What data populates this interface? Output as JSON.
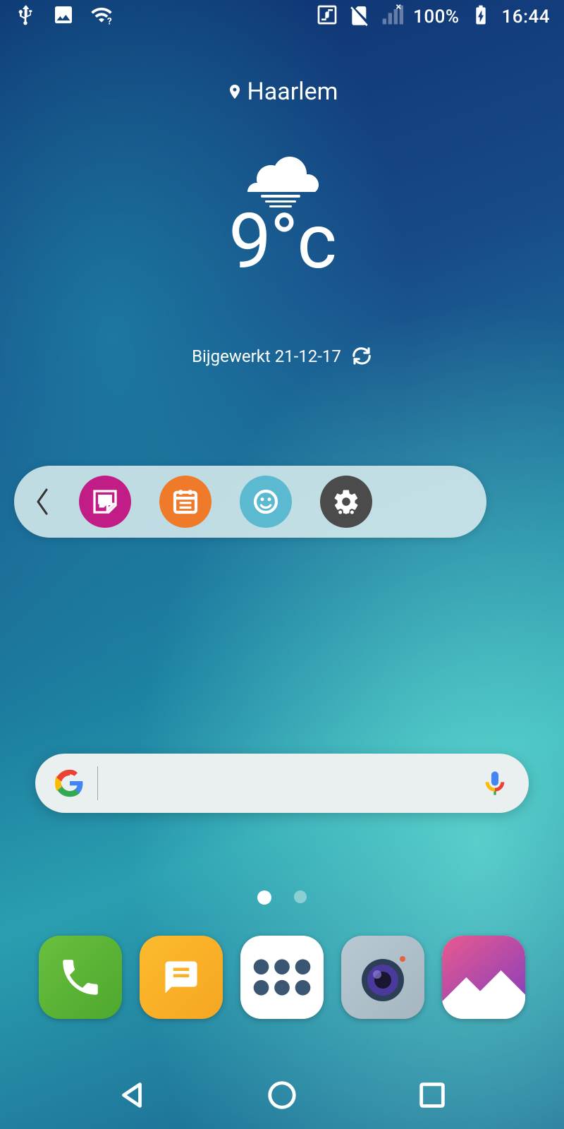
{
  "status": {
    "battery": "100%",
    "time": "16:44"
  },
  "weather": {
    "location": "Haarlem",
    "temperature": "9°c",
    "updated_label": "Bijgewerkt 21-12-17"
  },
  "bulletin": {
    "items": [
      "memo",
      "calendar",
      "smart-doctor",
      "settings"
    ]
  },
  "search": {
    "placeholder": ""
  },
  "pages": {
    "current": 0,
    "total": 2
  },
  "dock": {
    "apps": [
      "phone",
      "messages",
      "app-drawer",
      "camera",
      "gallery"
    ]
  }
}
